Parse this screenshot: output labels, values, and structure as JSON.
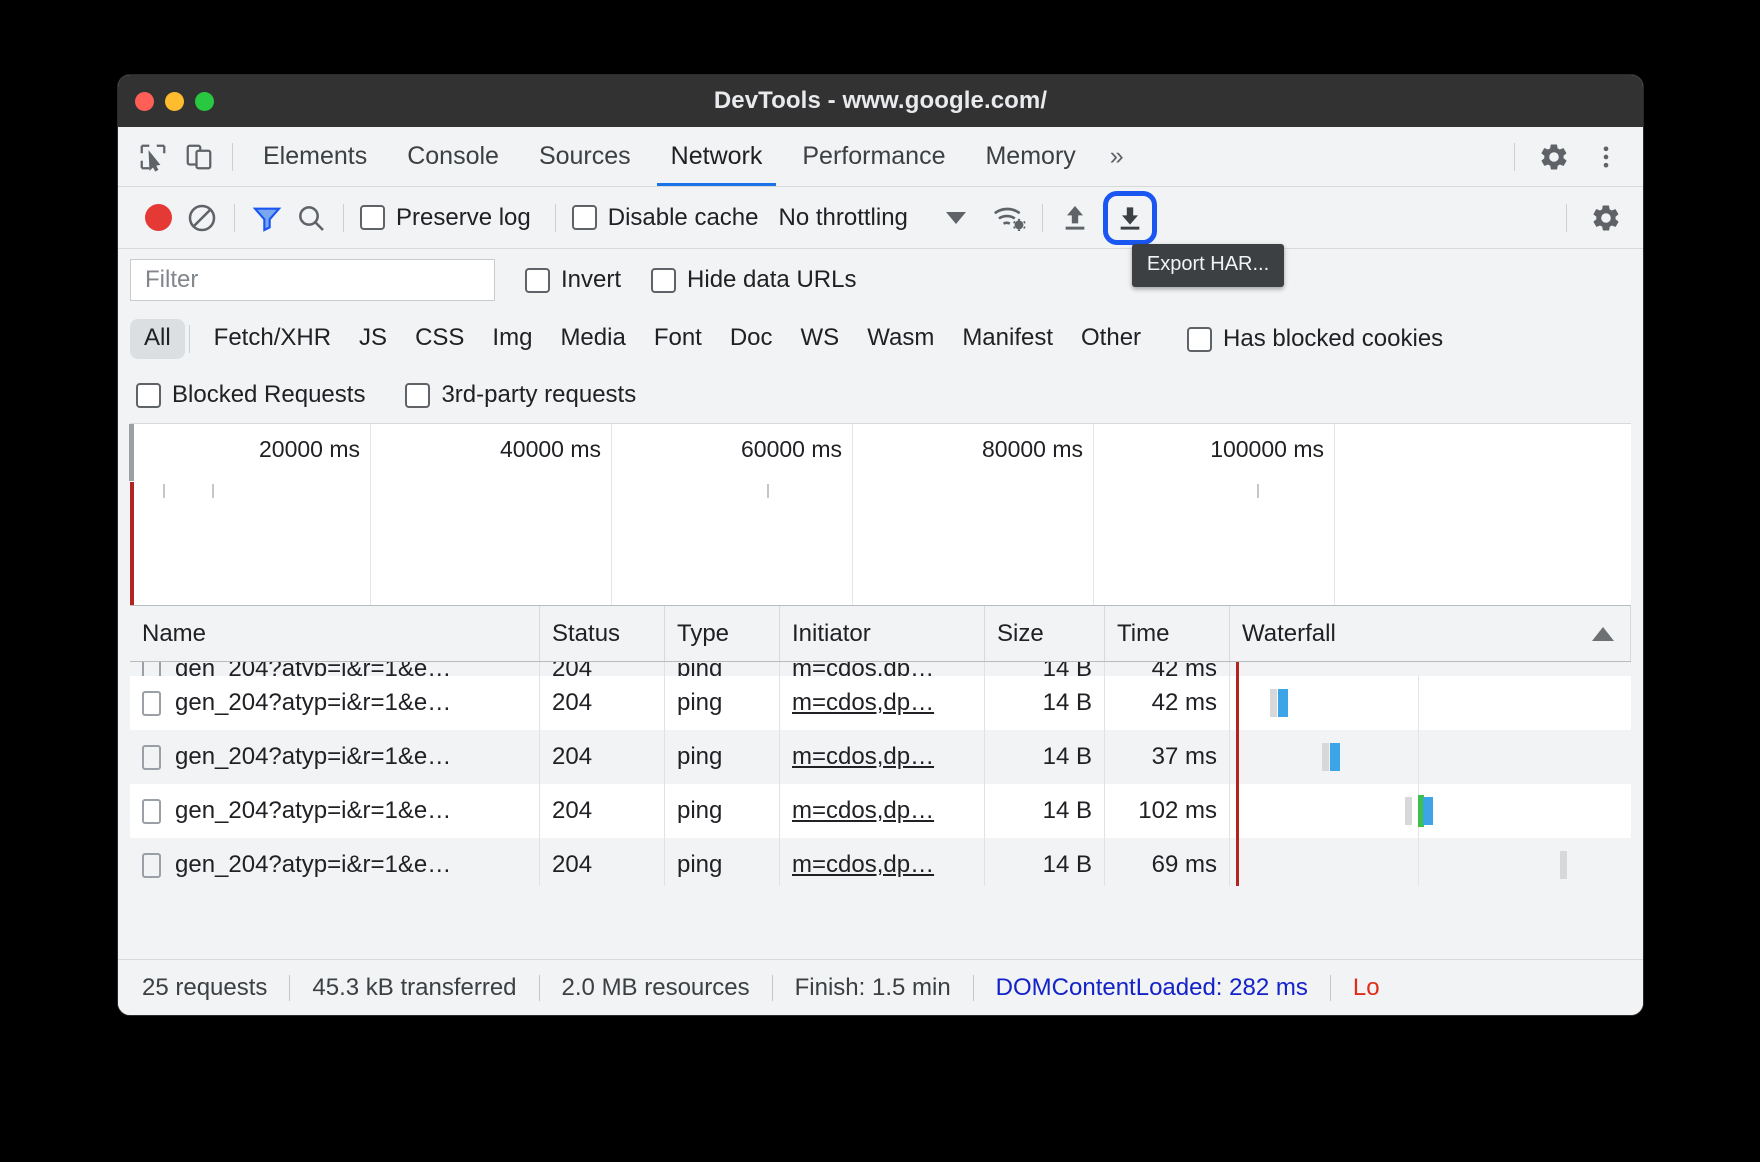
{
  "window": {
    "title": "DevTools - www.google.com/",
    "traffic_lights": [
      "close",
      "minimize",
      "maximize"
    ]
  },
  "tabbar": {
    "inspect_icon": "inspect-cursor-icon",
    "device_icon": "device-toolbar-icon",
    "tabs": [
      {
        "label": "Elements",
        "active": false
      },
      {
        "label": "Console",
        "active": false
      },
      {
        "label": "Sources",
        "active": false
      },
      {
        "label": "Network",
        "active": true
      },
      {
        "label": "Performance",
        "active": false
      },
      {
        "label": "Memory",
        "active": false
      }
    ],
    "more_tabs": "»",
    "settings_icon": "gear-icon",
    "menu_icon": "kebab-menu-icon"
  },
  "network_toolbar": {
    "record_button": "record-icon",
    "clear_button": "clear-icon",
    "filter_icon": "filter-funnel-icon",
    "search_icon": "search-icon",
    "preserve_log": {
      "label": "Preserve log",
      "checked": false
    },
    "disable_cache": {
      "label": "Disable cache",
      "checked": false
    },
    "throttling": {
      "value": "No throttling"
    },
    "network_conditions_icon": "wifi-gear-icon",
    "import_har_icon": "upload-arrow-icon",
    "export_har_icon": "download-arrow-icon",
    "export_har_tooltip": "Export HAR...",
    "settings_icon": "gear-icon"
  },
  "filter_row": {
    "filter_placeholder": "Filter",
    "invert": {
      "label": "Invert",
      "checked": false
    },
    "hide_data_urls": {
      "label": "Hide data URLs",
      "checked": false
    }
  },
  "type_filters": {
    "chips": [
      "All",
      "Fetch/XHR",
      "JS",
      "CSS",
      "Img",
      "Media",
      "Font",
      "Doc",
      "WS",
      "Wasm",
      "Manifest",
      "Other"
    ],
    "selected": "All",
    "has_blocked_cookies": {
      "label": "Has blocked cookies",
      "checked": false
    },
    "blocked_requests": {
      "label": "Blocked Requests",
      "checked": false
    },
    "third_party_requests": {
      "label": "3rd-party requests",
      "checked": false
    }
  },
  "overview": {
    "ticks": [
      "20000 ms",
      "40000 ms",
      "60000 ms",
      "80000 ms",
      "100000 ms"
    ]
  },
  "table": {
    "columns": [
      "Name",
      "Status",
      "Type",
      "Initiator",
      "Size",
      "Time",
      "Waterfall"
    ],
    "sort_column": "Waterfall",
    "sort_direction": "ascending",
    "rows": [
      {
        "name": "gen_204?atyp=i&r=1&e…",
        "status": "204",
        "type": "ping",
        "initiator": "m=cdos,dp…",
        "size": "14 B",
        "time": "42 ms"
      },
      {
        "name": "gen_204?atyp=i&r=1&e…",
        "status": "204",
        "type": "ping",
        "initiator": "m=cdos,dp…",
        "size": "14 B",
        "time": "37 ms"
      },
      {
        "name": "gen_204?atyp=i&r=1&e…",
        "status": "204",
        "type": "ping",
        "initiator": "m=cdos,dp…",
        "size": "14 B",
        "time": "102 ms"
      },
      {
        "name": "gen_204?atyp=i&r=1&e…",
        "status": "204",
        "type": "ping",
        "initiator": "m=cdos,dp…",
        "size": "14 B",
        "time": "69 ms"
      }
    ]
  },
  "status_bar": {
    "requests": "25 requests",
    "transferred": "45.3 kB transferred",
    "resources": "2.0 MB resources",
    "finish": "Finish: 1.5 min",
    "dom_content_loaded": "DOMContentLoaded: 282 ms",
    "load": "Lo"
  },
  "colors": {
    "accent": "#1a73e8",
    "focus_ring": "#1a56f0",
    "record": "#e53935",
    "dcl": "#1423c8",
    "load": "#e02d18",
    "waterfall_blue": "#3ba5e8",
    "waterfall_green": "#3ec14a"
  }
}
